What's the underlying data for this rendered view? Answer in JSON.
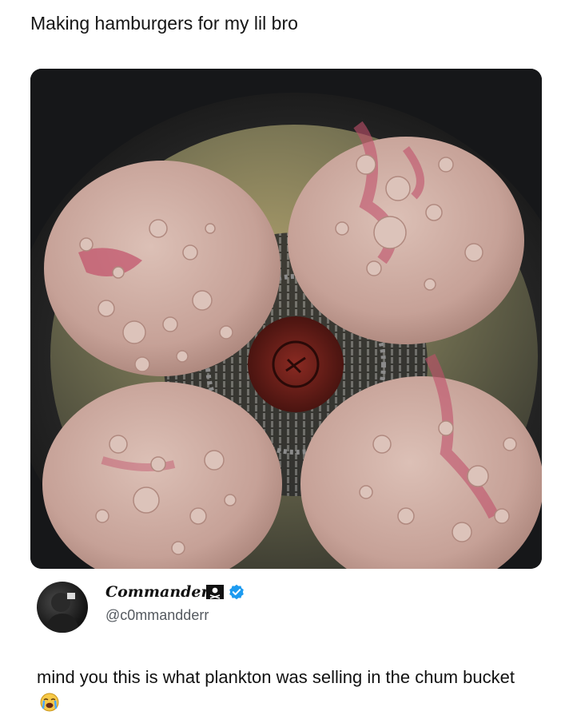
{
  "post": {
    "caption": "Making hamburgers for my lil bro"
  },
  "tweet": {
    "display_name": "Commander",
    "handle": "@c0mmandderr",
    "text": "mind you this is what plankton was selling in the chum bucket",
    "emoji": "loudly-crying-face-icon",
    "icons": [
      "pirate-flag-icon",
      "verified-badge-icon"
    ],
    "colors": {
      "verified": "#1d9bf0",
      "patty": "#c9a59a",
      "pan": "#1b1c1e"
    }
  }
}
